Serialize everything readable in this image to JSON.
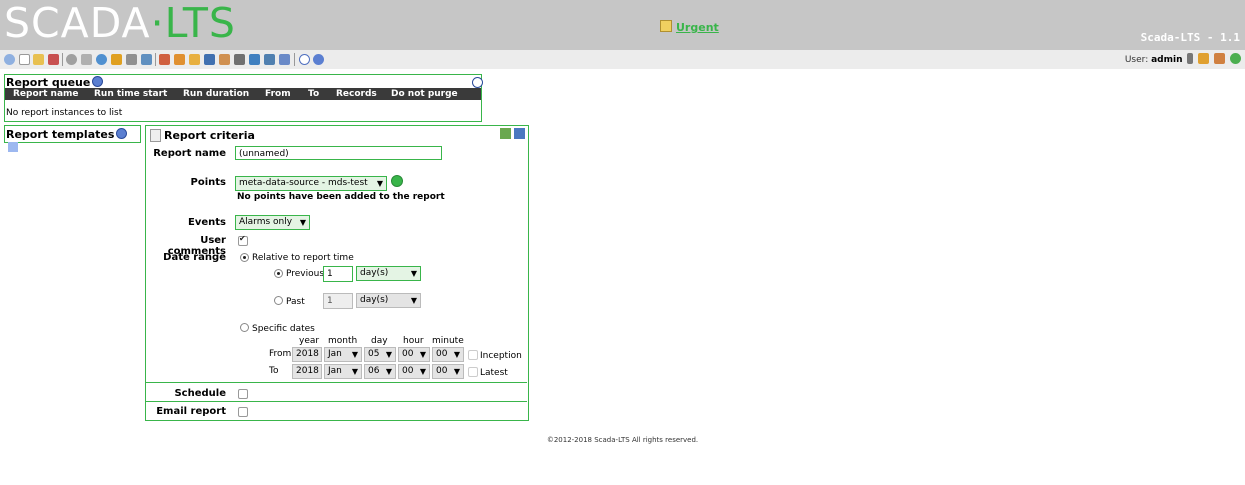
{
  "header": {
    "logo_left": "SCADA",
    "logo_right": "LTS",
    "urgent_label": "Urgent",
    "version": "Scada-LTS - 1.1",
    "user_prefix": "User:",
    "user_name": "admin"
  },
  "colors": {
    "accent": "#39b54a",
    "header_bg": "#c6c6c6",
    "table_head": "#3a3a3a"
  },
  "toolbar_icons": [
    "watchlist-icon",
    "graphic-views-icon",
    "alarms-icon",
    "reports-icon",
    "data-sources-icon",
    "scheduled-events-icon",
    "compound-events-icon",
    "point-links-icon",
    "scripting-icon",
    "users-icon",
    "user-profiles-icon",
    "point-hierarchy-icon",
    "mailing-lists-icon",
    "publishers-icon",
    "maintenance-events-icon",
    "system-settings-icon",
    "emport-icon",
    "sql-icon",
    "logout-icon",
    "help-icon"
  ],
  "report_queue": {
    "title": "Report queue",
    "columns": [
      "Report name",
      "Run time start",
      "Run duration",
      "From",
      "To",
      "Records",
      "Do not purge"
    ],
    "empty_message": "No report instances to list"
  },
  "report_templates": {
    "title": "Report templates"
  },
  "criteria": {
    "title": "Report criteria",
    "report_name_label": "Report name",
    "report_name_value": "(unnamed)",
    "points_label": "Points",
    "points_select": "meta-data-source - mds-test",
    "points_empty": "No points have been added to the report",
    "events_label": "Events",
    "events_select": "Alarms only",
    "user_comments_label": "User comments",
    "user_comments_checked": true,
    "date_range_label": "Date range",
    "relative_label": "Relative to report time",
    "previous_label": "Previous",
    "previous_value": "1",
    "previous_unit": "day(s)",
    "past_label": "Past",
    "past_value": "1",
    "past_unit": "day(s)",
    "specific_label": "Specific dates",
    "date_headers": [
      "year",
      "month",
      "day",
      "hour",
      "minute"
    ],
    "from_label": "From",
    "from": [
      "2018",
      "Jan",
      "05",
      "00",
      "00"
    ],
    "inception_label": "Inception",
    "to_label": "To",
    "to": [
      "2018",
      "Jan",
      "06",
      "00",
      "00"
    ],
    "latest_label": "Latest",
    "schedule_label": "Schedule",
    "email_label": "Email report"
  },
  "footer": "©2012-2018 Scada-LTS All rights reserved."
}
